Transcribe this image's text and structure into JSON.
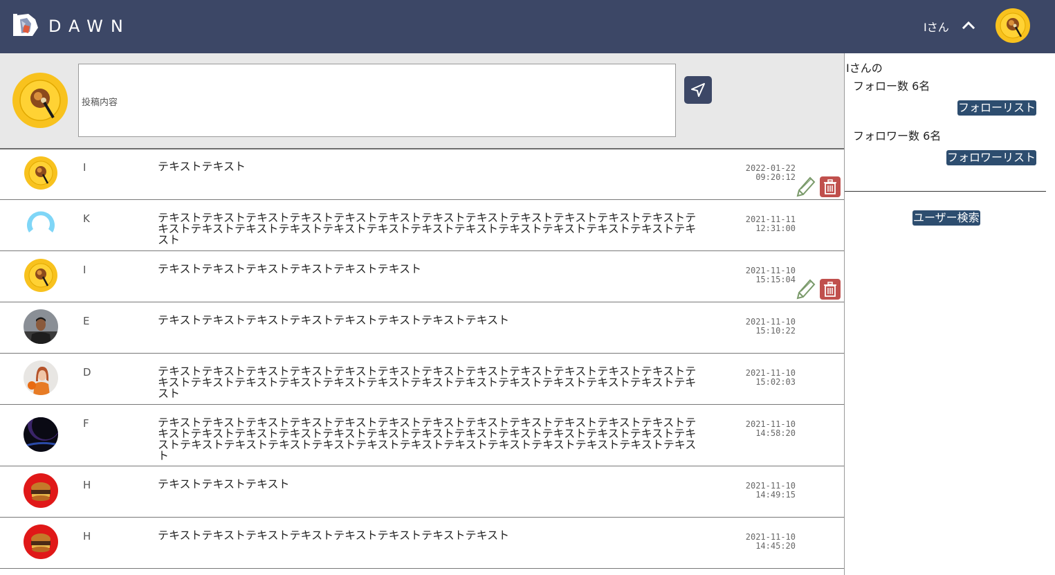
{
  "header": {
    "logo_text": "DAWN",
    "user_name": "Iさん"
  },
  "composer": {
    "placeholder": "投稿内容"
  },
  "posts": [
    {
      "user": "I",
      "text": "テキストテキスト",
      "date": "2022-01-22",
      "time": "09:20:12",
      "avatar": "plate",
      "own": true
    },
    {
      "user": "K",
      "text": "テキストテキストテキストテキストテキストテキストテキストテキストテキストテキストテキストテキストテキストテキストテキストテキストテキストテキストテキストテキストテキストテキストテキストテキストテキスト",
      "date": "2021-11-11",
      "time": "12:31:00",
      "avatar": "ring",
      "own": false
    },
    {
      "user": "I",
      "text": "テキストテキストテキストテキストテキストテキスト",
      "date": "2021-11-10",
      "time": "15:15:04",
      "avatar": "plate",
      "own": true
    },
    {
      "user": "E",
      "text": "テキストテキストテキストテキストテキストテキストテキストテキスト",
      "date": "2021-11-10",
      "time": "15:10:22",
      "avatar": "man",
      "own": false
    },
    {
      "user": "D",
      "text": "テキストテキストテキストテキストテキストテキストテキストテキストテキストテキストテキストテキストテキストテキストテキストテキストテキストテキストテキストテキストテキストテキストテキストテキストテキスト",
      "date": "2021-11-10",
      "time": "15:02:03",
      "avatar": "woman",
      "own": false
    },
    {
      "user": "F",
      "text": "テキストテキストテキストテキストテキストテキストテキストテキストテキストテキストテキストテキストテキストテキストテキストテキストテキストテキストテキストテキストテキストテキストテキストテキストテキストテキストテキストテキストテキストテキストテキストテキストテキストテキストテキストテキストテキスト",
      "date": "2021-11-10",
      "time": "14:58:20",
      "avatar": "planet",
      "own": false
    },
    {
      "user": "H",
      "text": "テキストテキストテキスト",
      "date": "2021-11-10",
      "time": "14:49:15",
      "avatar": "burger",
      "own": false
    },
    {
      "user": "H",
      "text": "テキストテキストテキストテキストテキストテキストテキストテキスト",
      "date": "2021-11-10",
      "time": "14:45:20",
      "avatar": "burger",
      "own": false
    }
  ],
  "sidebar": {
    "owner_label": "Iさんの",
    "follow_count": "フォロー数 6名",
    "follow_list_button": "フォローリスト",
    "follower_count": "フォロワー数 6名",
    "follower_list_button": "フォロワーリスト",
    "user_search_button": "ユーザー検索"
  },
  "icons": {
    "send": "send-icon",
    "edit": "pencil-icon",
    "delete": "trash-icon",
    "chevron": "chevron-up-icon"
  },
  "colors": {
    "header_bg": "#3c4766",
    "button_bg": "#2d4d6f",
    "delete_bg": "#c0504d",
    "edit_green": "#7a9a6a"
  }
}
